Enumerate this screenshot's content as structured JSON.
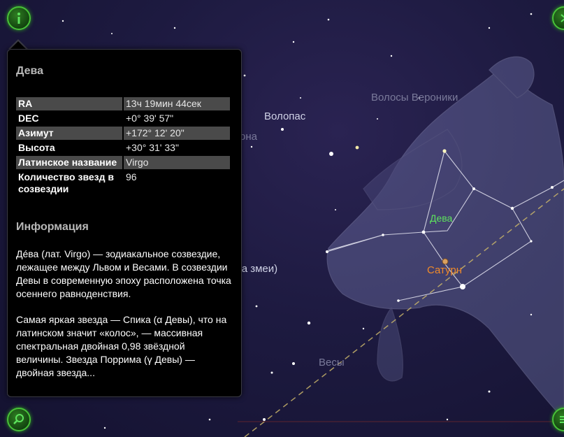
{
  "panel": {
    "title": "Дева",
    "properties": [
      {
        "key": "RA",
        "value": "13ч 19мин 44сек"
      },
      {
        "key": "DEC",
        "value": "+0° 39' 57\""
      },
      {
        "key": "Азимут",
        "value": "+172° 12' 20\""
      },
      {
        "key": "Высота",
        "value": "+30° 31' 33\""
      },
      {
        "key": "Латинское название",
        "value": "Virgo"
      },
      {
        "key": "Количество звезд в созвездии",
        "value": "96"
      }
    ],
    "info_heading": "Информация",
    "paragraphs": [
      "Дéва (лат. Virgo) — зодиакальное созвездие, лежащее между Львом и Весами. В созвездии Девы в современную эпоху расположена точка осеннего равноденствия.",
      "Самая яркая звезда — Спика (α Девы), что на латинском значит «колос», — массивная спектральная двойная 0,98 звёздной величины. Звезда Поррима (γ Девы) — двойная звезда..."
    ]
  },
  "sky_labels": {
    "volopas": "Волопас",
    "volosy_veroniki": "Волосы Вероники",
    "deva": "Дева",
    "saturn": "Сатурн",
    "vesy": "Весы",
    "zmei_partial": "та змеи)",
    "ona_partial": "она"
  },
  "buttons": {
    "info_icon": "info-icon",
    "search_icon": "search-icon",
    "menu_icon": "menu-icon",
    "next_icon": "chevron-right-icon"
  },
  "colors": {
    "button_green": "#48c238",
    "constellation_label": "#5de35d",
    "planet_label": "#f08a2a",
    "ecliptic": "#c8b46a"
  }
}
